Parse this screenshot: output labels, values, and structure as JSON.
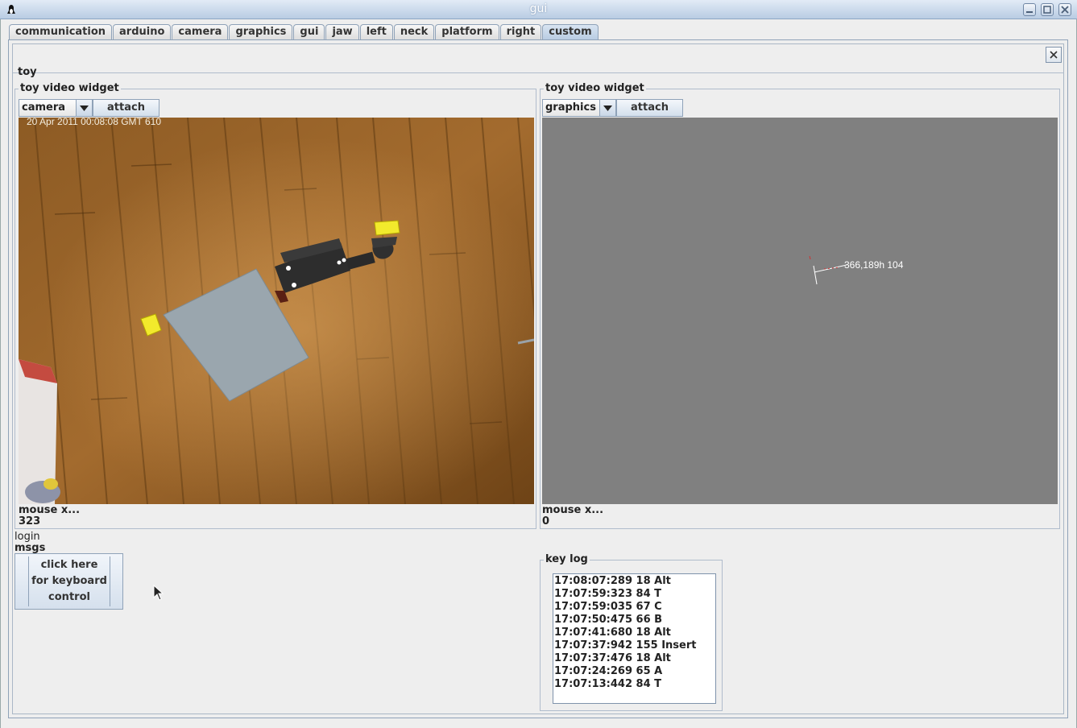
{
  "window": {
    "title": "gui"
  },
  "tabs": [
    "communication",
    "arduino",
    "camera",
    "graphics",
    "gui",
    "jaw",
    "left",
    "neck",
    "platform",
    "right",
    "custom"
  ],
  "active_tab": "custom",
  "panel": {
    "title": "toy"
  },
  "left_widget": {
    "title": "toy  video widget",
    "source": "camera",
    "attach_label": "attach",
    "timestamp": "20 Apr 2011 00:08:08 GMT 610",
    "mouse_label": "mouse x...",
    "mouse_value": "323"
  },
  "right_widget": {
    "title": "toy  video widget",
    "source": "graphics",
    "attach_label": "attach",
    "overlay_text": "366,189h 104",
    "mouse_label": "mouse x...",
    "mouse_value": "0"
  },
  "login_label": "login",
  "msgs_label": "msgs",
  "keyboard_button": {
    "line1": "click here",
    "line2": "for keyboard",
    "line3": "control"
  },
  "key_log": {
    "title": "key log",
    "entries": [
      "17:08:07:289 18 Alt",
      "17:07:59:323 84 T",
      "17:07:59:035 67 C",
      "17:07:50:475 66 B",
      "17:07:41:680 18 Alt",
      "17:07:37:942 155 Insert",
      "17:07:37:476 18 Alt",
      "17:07:24:269 65 A",
      "17:07:13:442 84 T"
    ]
  },
  "colors": {
    "floor": "#8a5a22",
    "graphics_bg": "#808080",
    "accent": "#b7cbe2"
  }
}
